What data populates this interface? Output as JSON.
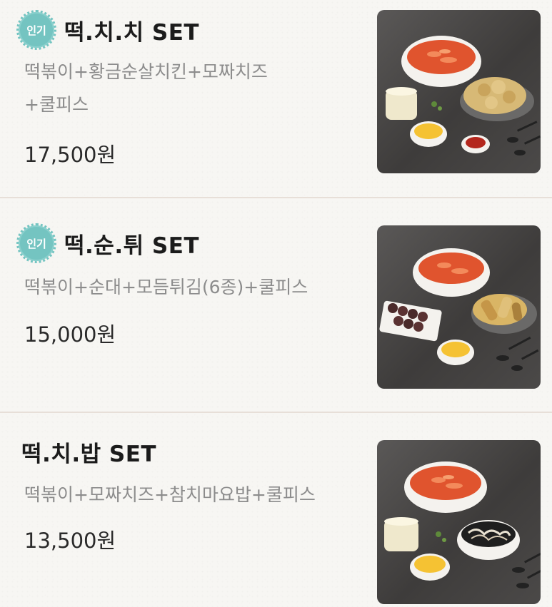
{
  "menu": [
    {
      "badge": "인기",
      "title": "떡.치.치 SET",
      "desc_lines": [
        "떡볶이+황금순살치킨+모짜치즈",
        "+쿨피스"
      ],
      "price": "17,500원"
    },
    {
      "badge": "인기",
      "title": "떡.순.튀 SET",
      "desc_lines": [
        "떡볶이+순대+모듬튀김(6종)+쿨피스"
      ],
      "price": "15,000원"
    },
    {
      "badge": "",
      "title": "떡.치.밥 SET",
      "desc_lines": [
        "떡볶이+모짜치즈+참치마요밥+쿨피스"
      ],
      "price": "13,500원"
    }
  ],
  "colors": {
    "badge": "#74c4c1",
    "divider": "#e7dfd8",
    "description": "#8c8c8c",
    "tteokbokki": "#e0542e"
  },
  "icons": [
    "food-photo-tteokbokki-chicken-set",
    "food-photo-tteokbokki-sundae-fried-set",
    "food-photo-tteokbokki-rice-set"
  ]
}
